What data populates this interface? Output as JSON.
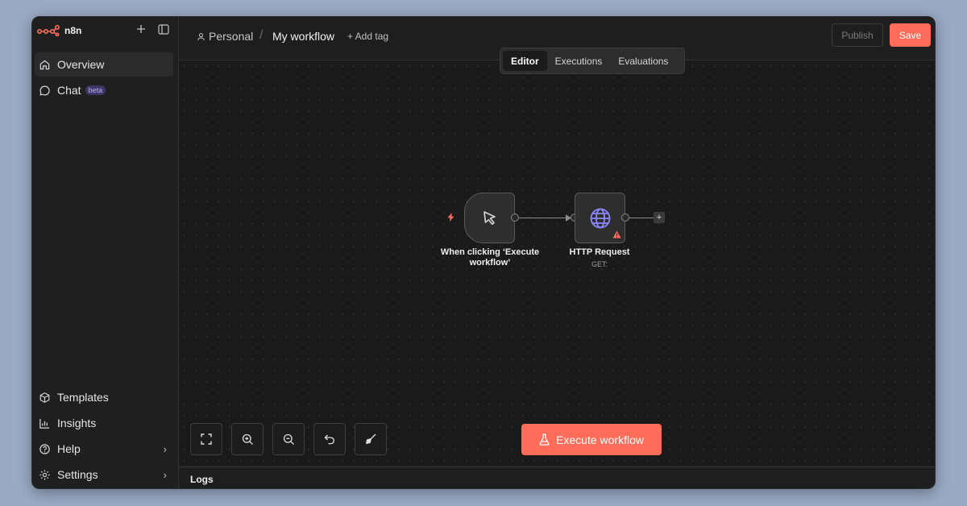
{
  "app": {
    "brand": "n8n",
    "accent_color": "#ff6d5a"
  },
  "sidebar": {
    "top_items": [
      {
        "label": "Overview",
        "icon": "home-icon",
        "active": true
      },
      {
        "label": "Chat",
        "icon": "chat-icon",
        "badge": "beta"
      }
    ],
    "bottom_items": [
      {
        "label": "Templates",
        "icon": "box-icon"
      },
      {
        "label": "Insights",
        "icon": "chart-icon"
      },
      {
        "label": "Help",
        "icon": "help-icon",
        "has_submenu": true
      },
      {
        "label": "Settings",
        "icon": "gear-icon",
        "has_submenu": true
      }
    ]
  },
  "header": {
    "project": "Personal",
    "separator": "/",
    "workflow_name": "My workflow",
    "add_tag": "+ Add tag",
    "publish_label": "Publish",
    "save_label": "Save",
    "tabs": [
      {
        "label": "Editor",
        "active": true
      },
      {
        "label": "Executions"
      },
      {
        "label": "Evaluations"
      }
    ]
  },
  "canvas": {
    "nodes": [
      {
        "label": "When clicking ‘Execute workflow’",
        "icon": "cursor-click-icon"
      },
      {
        "label": "HTTP Request",
        "subtitle": "GET:",
        "icon": "globe-icon",
        "warning": true
      }
    ],
    "controls": [
      "fit-view",
      "zoom-in",
      "zoom-out",
      "undo",
      "tidy-up"
    ],
    "execute_label": "Execute workflow"
  },
  "logs": {
    "label": "Logs"
  }
}
